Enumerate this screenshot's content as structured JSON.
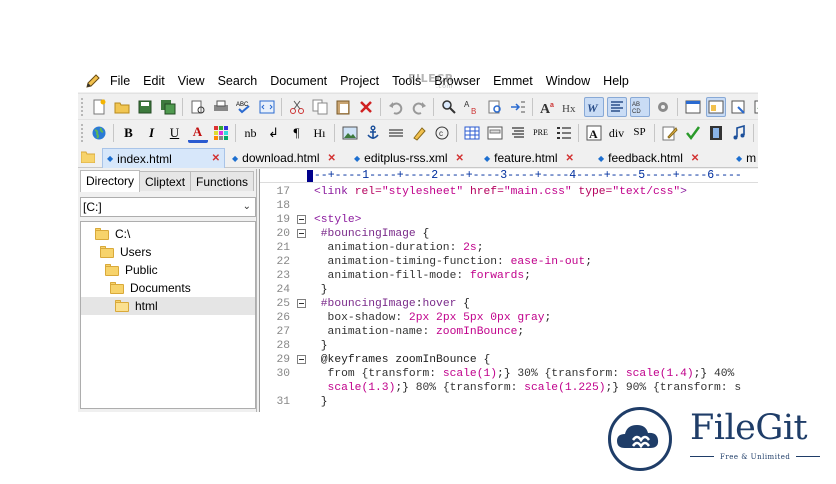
{
  "menu": [
    "File",
    "Edit",
    "View",
    "Search",
    "Document",
    "Project",
    "Tools",
    "Browser",
    "Emmet",
    "Window",
    "Help"
  ],
  "toolbar1_icons": [
    "new-file-icon",
    "open-icon",
    "save-icon",
    "save-all-icon",
    "print-preview-icon",
    "print-icon",
    "spell-check-icon",
    "browser-preview-icon",
    "cut-icon",
    "copy-icon",
    "paste-icon",
    "delete-icon",
    "undo-icon",
    "redo-icon",
    "find-icon",
    "replace-icon",
    "find-in-files-icon",
    "goto-line-icon",
    "font-icon",
    "hex-icon",
    "word-wrap-icon",
    "line-number-icon",
    "column-icon",
    "settings-icon",
    "window-icon",
    "window-icon-2",
    "window-icon-3",
    "window-icon-4",
    "cursor-icon"
  ],
  "toolbar2_icons": [
    "globe-icon",
    "bold-icon",
    "italic-icon",
    "underline-icon",
    "font-color-icon",
    "color-grid-icon",
    "nbsp-icon",
    "line-break-icon",
    "paragraph-icon",
    "heading-icon",
    "image-icon",
    "anchor-icon",
    "hr-icon",
    "marker-icon",
    "copyright-icon",
    "table-icon",
    "form-icon",
    "list-icon",
    "pre-icon",
    "list-items-icon",
    "tag-a-icon",
    "div-icon",
    "span-icon",
    "edit-icon",
    "validate-icon",
    "film-icon",
    "music-icon",
    "window-icon-5",
    "window-icon-6"
  ],
  "toolbar2_text": {
    "bold": "B",
    "italic": "I",
    "underline": "U",
    "font_color": "A",
    "nbsp": "nb",
    "line_break": "↲",
    "paragraph": "¶",
    "heading": "Hı",
    "pre": "PRE",
    "div": "div",
    "span": "SP"
  },
  "tabs": [
    {
      "label": "index.html",
      "active": true
    },
    {
      "label": "download.html",
      "active": false
    },
    {
      "label": "editplus-rss.xml",
      "active": false
    },
    {
      "label": "feature.html",
      "active": false
    },
    {
      "label": "feedback.html",
      "active": false
    },
    {
      "label": "m",
      "active": false
    }
  ],
  "panel": {
    "tabs": [
      "Directory",
      "Cliptext",
      "Functions"
    ],
    "drive": "[C:]",
    "tree": [
      "C:\\",
      "Users",
      "Public",
      "Documents",
      "html"
    ]
  },
  "ruler": "---+----1----+----2----+----3----+----4----+----5----+----6----",
  "code_lines": [
    {
      "n": "17",
      "fold": false,
      "parts": [
        [
          "t",
          "<link "
        ],
        [
          "a",
          "rel="
        ],
        [
          "s",
          "\"stylesheet\""
        ],
        [
          "a",
          " href="
        ],
        [
          "s",
          "\"main.css\""
        ],
        [
          "a",
          " type="
        ],
        [
          "s",
          "\"text/css\""
        ],
        [
          "t",
          ">"
        ]
      ]
    },
    {
      "n": "18",
      "fold": false,
      "parts": []
    },
    {
      "n": "19",
      "fold": true,
      "parts": [
        [
          "t",
          "<style>"
        ]
      ]
    },
    {
      "n": "20",
      "fold": true,
      "parts": [
        [
          "x",
          " #bouncingImage "
        ],
        [
          "d",
          "{"
        ]
      ]
    },
    {
      "n": "21",
      "fold": false,
      "parts": [
        [
          "p",
          "  animation-duration: "
        ],
        [
          "s",
          "2s"
        ],
        [
          "d",
          ";"
        ]
      ]
    },
    {
      "n": "22",
      "fold": false,
      "parts": [
        [
          "p",
          "  animation-timing-function: "
        ],
        [
          "s",
          "ease-in-out"
        ],
        [
          "d",
          ";"
        ]
      ]
    },
    {
      "n": "23",
      "fold": false,
      "parts": [
        [
          "p",
          "  animation-fill-mode: "
        ],
        [
          "s",
          "forwards"
        ],
        [
          "d",
          ";"
        ]
      ]
    },
    {
      "n": "24",
      "fold": false,
      "parts": [
        [
          "d",
          " }"
        ]
      ]
    },
    {
      "n": "25",
      "fold": true,
      "parts": [
        [
          "x",
          " #bouncingImage"
        ],
        [
          "d",
          ":"
        ],
        [
          "x",
          "hover "
        ],
        [
          "d",
          "{"
        ]
      ]
    },
    {
      "n": "26",
      "fold": false,
      "parts": [
        [
          "p",
          "  box-shadow: "
        ],
        [
          "s",
          "2px 2px 5px 0px gray"
        ],
        [
          "d",
          ";"
        ]
      ]
    },
    {
      "n": "27",
      "fold": false,
      "parts": [
        [
          "p",
          "  animation-name: "
        ],
        [
          "s",
          "zoomInBounce"
        ],
        [
          "d",
          ";"
        ]
      ]
    },
    {
      "n": "28",
      "fold": false,
      "parts": [
        [
          "d",
          " }"
        ]
      ]
    },
    {
      "n": "29",
      "fold": true,
      "parts": [
        [
          "d",
          " @keyframes zoomInBounce {"
        ]
      ]
    },
    {
      "n": "30",
      "fold": false,
      "parts": [
        [
          "p",
          "  from {transform: "
        ],
        [
          "s",
          "scale(1)"
        ],
        [
          "d",
          ";}"
        ],
        [
          "p",
          " 30% {transform: "
        ],
        [
          "s",
          "scale(1.4)"
        ],
        [
          "d",
          ";}"
        ],
        [
          "p",
          " 40%"
        ]
      ]
    },
    {
      "n": "",
      "fold": false,
      "parts": [
        [
          "s",
          "  scale(1.3)"
        ],
        [
          "d",
          ";}"
        ],
        [
          "p",
          " 80% {transform: "
        ],
        [
          "s",
          "scale(1.225)"
        ],
        [
          "d",
          ";}"
        ],
        [
          "p",
          " 90% {transform: s"
        ]
      ]
    },
    {
      "n": "31",
      "fold": false,
      "parts": [
        [
          "d",
          " }"
        ]
      ]
    }
  ],
  "watermark": {
    "top": "FILECR",
    "top_sub": ".com",
    "name": "FileGit",
    "tagline": "Free & Unlimited"
  },
  "colors": {
    "logo": "#1f3d68",
    "tab_active": "#d7e7fa",
    "string": "#c0008b",
    "tag": "#8b1a9e"
  }
}
